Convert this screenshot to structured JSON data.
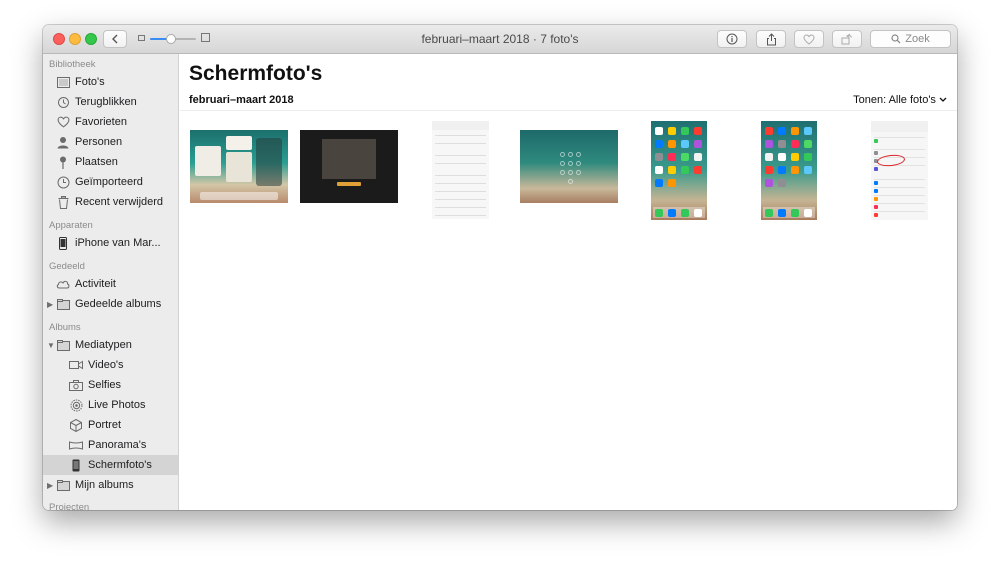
{
  "window": {
    "title": "februari–maart 2018 · 7 foto's"
  },
  "toolbar": {
    "back_icon": "chevron-left-icon",
    "info_icon": "info-icon",
    "share_icon": "share-icon",
    "favorite_icon": "heart-icon",
    "rotate_icon": "rotate-icon",
    "search_placeholder": "Zoek",
    "zoom_level": 0.45
  },
  "sidebar": {
    "sections": [
      {
        "header": "Bibliotheek",
        "items": [
          {
            "label": "Foto's",
            "icon": "photos-icon"
          },
          {
            "label": "Terugblikken",
            "icon": "memories-icon"
          },
          {
            "label": "Favorieten",
            "icon": "heart-icon"
          },
          {
            "label": "Personen",
            "icon": "person-icon"
          },
          {
            "label": "Plaatsen",
            "icon": "pin-icon"
          },
          {
            "label": "Geïmporteerd",
            "icon": "clock-icon"
          },
          {
            "label": "Recent verwijderd",
            "icon": "trash-icon"
          }
        ]
      },
      {
        "header": "Apparaten",
        "items": [
          {
            "label": "iPhone van Mar...",
            "icon": "iphone-icon"
          }
        ]
      },
      {
        "header": "Gedeeld",
        "items": [
          {
            "label": "Activiteit",
            "icon": "cloud-icon"
          },
          {
            "label": "Gedeelde albums",
            "icon": "folder-icon"
          }
        ]
      },
      {
        "header": "Albums",
        "items": [
          {
            "label": "Mediatypen",
            "icon": "folder-icon"
          },
          {
            "label": "Video's",
            "icon": "video-icon"
          },
          {
            "label": "Selfies",
            "icon": "camera-icon"
          },
          {
            "label": "Live Photos",
            "icon": "live-photo-icon"
          },
          {
            "label": "Portret",
            "icon": "cube-icon"
          },
          {
            "label": "Panorama's",
            "icon": "panorama-icon"
          },
          {
            "label": "Schermfoto's",
            "icon": "screenshot-icon",
            "selected": true
          },
          {
            "label": "Mijn albums",
            "icon": "folder-icon"
          }
        ]
      },
      {
        "header": "Projecten",
        "items": []
      }
    ]
  },
  "main": {
    "title": "Schermfoto's",
    "moment_title": "februari–maart 2018",
    "filter_label": "Tonen: Alle foto's",
    "chevron": "⌄"
  },
  "thumbnails": [
    {
      "name": "ipad-multitask-screenshot"
    },
    {
      "name": "ipad-video-screenshot"
    },
    {
      "name": "iphone-settings-screenshot"
    },
    {
      "name": "ipad-lockscreen-screenshot"
    },
    {
      "name": "iphone-homescreen-screenshot"
    },
    {
      "name": "iphone-homescreen-screenshot-2"
    },
    {
      "name": "iphone-settings-annotated-screenshot"
    }
  ],
  "colors": {
    "accent": "#3b8df5",
    "sidebar_bg": "#ececec",
    "selection": "#d4d4d4"
  }
}
